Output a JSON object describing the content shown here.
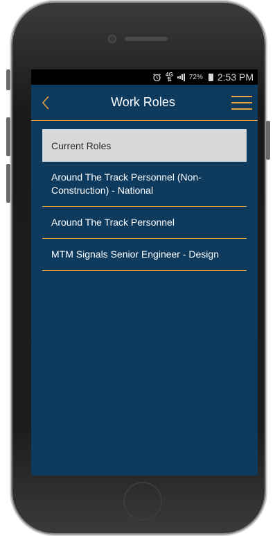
{
  "status_bar": {
    "alarm_icon": "alarm-clock-icon",
    "network_top": "4G",
    "network_bottom": "⇅",
    "battery_percent": "72%",
    "time": "2:53 PM"
  },
  "nav": {
    "title": "Work Roles",
    "back_icon": "chevron-left-icon",
    "menu_icon": "hamburger-menu-icon"
  },
  "roles": {
    "header": "Current Roles",
    "items": [
      {
        "label": "Around The Track Personnel (Non-Construction) - National"
      },
      {
        "label": "Around The Track Personnel"
      },
      {
        "label": "MTM Signals Senior Engineer - Design"
      }
    ]
  },
  "colors": {
    "accent": "#e8a23c",
    "background": "#0e3a5e",
    "header_bg": "#d6d8da"
  }
}
